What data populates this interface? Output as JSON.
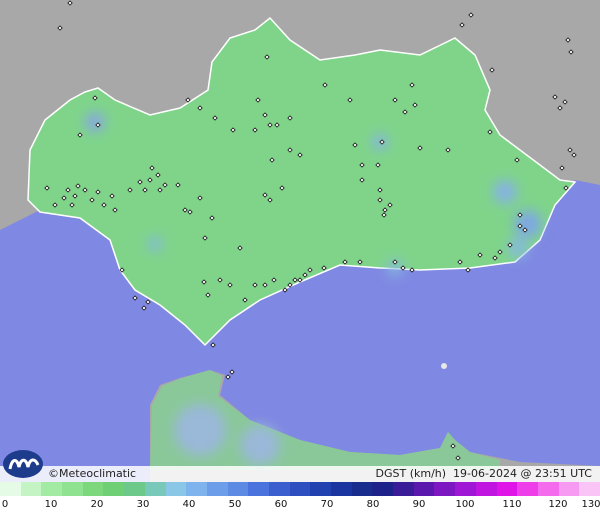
{
  "map": {
    "brand": "©Meteoclimatic",
    "variable_label": "DGST (km/h)",
    "date": "19-06-2024",
    "at": "@",
    "time": "23:51 UTC",
    "colors": {
      "sea": "#7f88e2",
      "land_outside": "#a7a7a7",
      "region_fill": "#7fd48a",
      "border": "#ffffff",
      "station": "#111111"
    }
  },
  "legend": {
    "ticks": [
      "0",
      "10",
      "20",
      "30",
      "40",
      "50",
      "60",
      "70",
      "80",
      "90",
      "100",
      "110",
      "120",
      "130"
    ],
    "colors": [
      "#e6fbe6",
      "#c4f3c4",
      "#a3eba3",
      "#8fe28f",
      "#7dd87d",
      "#6fcf74",
      "#6cc98a",
      "#78c9b9",
      "#8ac7e6",
      "#7fb3ee",
      "#6b9de8",
      "#5d8ae2",
      "#4a73dd",
      "#3b5fcf",
      "#2e4fc0",
      "#2241b1",
      "#1a35a0",
      "#172c8c",
      "#1d228a",
      "#3a1c99",
      "#5a18ad",
      "#7c17c2",
      "#9f16d4",
      "#c014e0",
      "#df14e6",
      "#ee3ee9",
      "#f46bee",
      "#f79af2",
      "#fac4f6"
    ]
  }
}
